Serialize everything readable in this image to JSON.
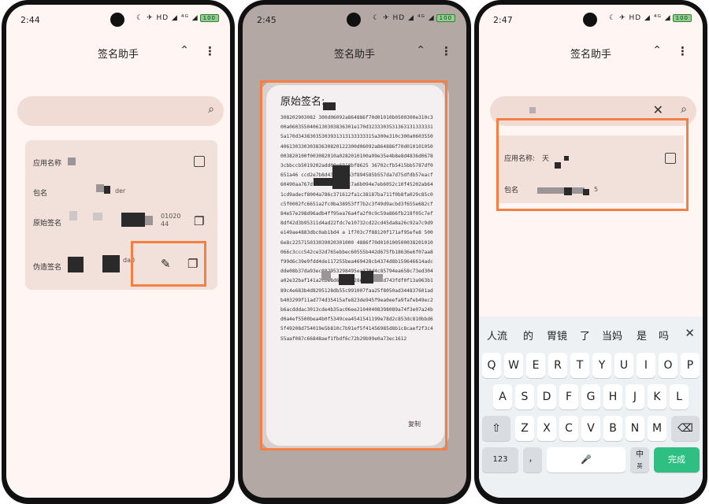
{
  "app": {
    "title": "签名助手",
    "chevron_glyph": "⌃",
    "more_glyph": "⋮"
  },
  "screens": [
    {
      "time": "2:44",
      "status_icons": "☾ ✈ HD ◢ ⁴ᴳ ◢",
      "battery": "100"
    },
    {
      "time": "2:45",
      "status_icons": "☾ ✈ HD ◢ ⁴ᴳ ◢",
      "battery": "100"
    },
    {
      "time": "2:47",
      "status_icons": "☾ ✈ HD ◢ ⁴ᴳ ◢",
      "battery": "100"
    }
  ],
  "icons": {
    "search": "⌕",
    "clear": "✕",
    "copy": "❐",
    "edit": "✎",
    "checkbox": "checkbox-icon"
  },
  "card": {
    "app_name_label": "应用名称",
    "package_label": "包名",
    "package_value": "der",
    "original_sig_label": "原始签名",
    "original_sig_value": "01020\n44",
    "fake_sig_label": "伪造签名",
    "fake_sig_value": "da0"
  },
  "screen3_card": {
    "app_name_label": "应用名称:",
    "app_name_value": "天",
    "package_label": "包名",
    "package_value": "5"
  },
  "dialog": {
    "title": "原始签名:",
    "signature": "308202903082 300d06092a864886f70d01010b0500300e310c300a0603550406130303836301e170d32333035313631313333315a170d34383035303931313133333315a300e310c300a060355040613033030383630820122300d06092a864886f70d010101050003820100f003082010a0282010100a99e35e4b8e8d4836d06783cbbccb5019202add00e6918bf8625 36702cfb5415bb5787df0651a46 ccd2e7b8d438aa1253f894585b557da7d75dfdb57eacf60490aa767dfd1145cecc26c7a6b094e7eb6052c10f45202ab641cd9adecf8004a786c371612fa1c38187ba711f0b8fa029c85c0c5f0002fc6651a2fc0ba38953ff7b2c3f49d9acbd3f655e682cf84e57e298d96adb4ff95ea76a4fa2f0c9c59a866fb218f05c7ef8df42d3b95311d4ad22fdc7e10732cd22cd45da8a26c92a7c9d9e149ae4883dbc0ab1bd4 a 1f703c7f88120f171af95efe8 5006e8c225715033039020301000 4886f70d010100500038201010066c3ccc542ce32d765ebbec60555b442d675fb18636e6f07aa8f99d6c39e9fdd4de117255bea469428cb4374d8b159646614adcdde08b37da93ec082953298495ea370d4c85794ea658c73ed304a02e32baf141a2cbe8d60959c28d4ea8101d743fdf0f13a963b189c4e683b4d8295128db55c991007faa25f8050ad344837601adb403299f11ad774d35415afe823de945f9ea0eefa9fafeb49ec2b6acdddac3013cde4b35ac06ee21040408398089a74f3e07a24bd0a4ef5500bea4b0f5349cea4541541199e78d2c853dc810bbd65f49208d754019e5b810c7b91ef5f41456985d8b1c8caef2f3c455aaf087c66848aef1fbdf6c72b29b99e0a73ec1612",
    "copy_label": "复制"
  },
  "search": {
    "value": ""
  },
  "keyboard": {
    "candidates": [
      "人流",
      "的",
      "胃镜",
      "了",
      "当妈",
      "是",
      "吗"
    ],
    "candidate_close": "✕",
    "row1": [
      "Q",
      "W",
      "E",
      "R",
      "T",
      "Y",
      "U",
      "I",
      "O",
      "P"
    ],
    "row2": [
      "A",
      "S",
      "D",
      "F",
      "G",
      "H",
      "J",
      "K",
      "L"
    ],
    "row3": [
      "Z",
      "X",
      "C",
      "V",
      "B",
      "N",
      "M"
    ],
    "shift": "⇧",
    "backspace": "⌫",
    "num_key": "123",
    "punct_key": "，",
    "mic": "🎤",
    "lang_key": "中",
    "lang_sub": "英",
    "done_key": "完成"
  },
  "colors": {
    "highlight": "#f47f45",
    "done": "#2fbf82",
    "card": "#f2e0da",
    "bg": "#fff6f3"
  }
}
